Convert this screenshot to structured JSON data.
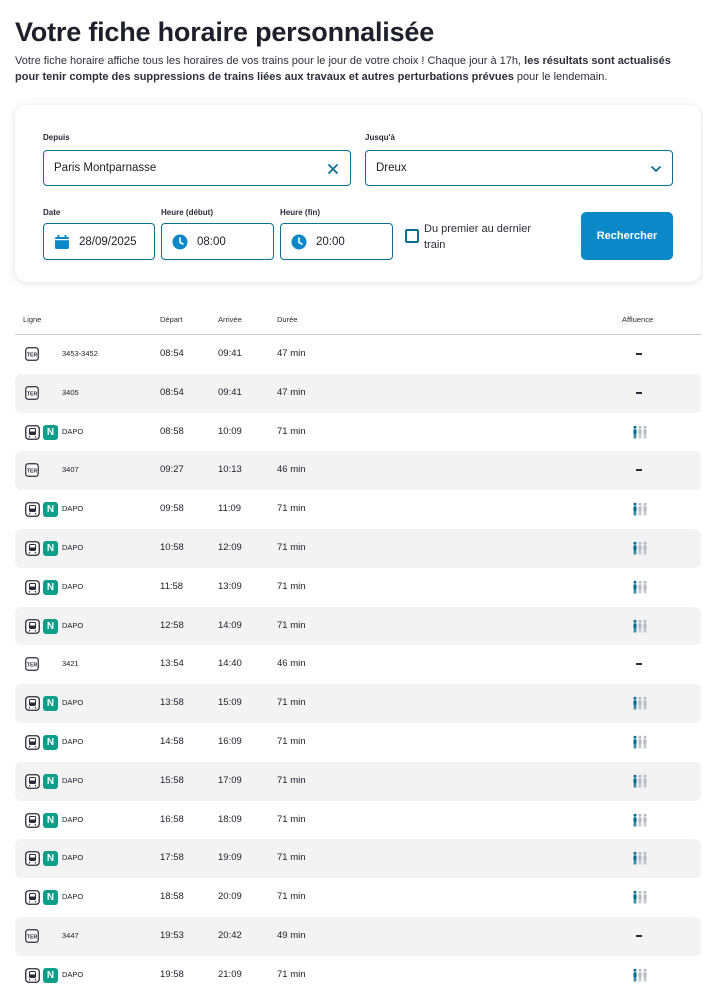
{
  "page": {
    "title": "Votre fiche horaire personnalisée",
    "intro_start": "Votre fiche horaire affiche tous les horaires de vos trains pour le jour de votre choix ! Chaque jour à 17h, ",
    "intro_bold": "les résultats sont actualisés pour tenir compte des suppressions de trains liées aux travaux et autres perturbations prévues",
    "intro_end": " pour le lendemain."
  },
  "form": {
    "from_label": "Depuis",
    "from_value": "Paris Montparnasse",
    "to_label": "Jusqu'à",
    "to_value": "Dreux",
    "date_label": "Date",
    "date_value": "28/09/2025",
    "start_label": "Heure (début)",
    "start_value": "08:00",
    "end_label": "Heure (fin)",
    "end_value": "20:00",
    "checkbox_label": "Du premier au dernier train",
    "search_button": "Rechercher"
  },
  "table": {
    "headers": {
      "ligne": "Ligne",
      "depart": "Départ",
      "arrivee": "Arrivée",
      "duree": "Durée",
      "affluence": "Affluence"
    },
    "rows": [
      {
        "type": "TER",
        "line": "3453-3452",
        "dep": "08:54",
        "arr": "09:41",
        "dur": "47 min",
        "aff": "none"
      },
      {
        "type": "TER",
        "line": "3405",
        "dep": "08:54",
        "arr": "09:41",
        "dur": "47 min",
        "aff": "none"
      },
      {
        "type": "N",
        "line": "DAPO",
        "dep": "08:58",
        "arr": "10:09",
        "dur": "71 min",
        "aff": "low"
      },
      {
        "type": "TER",
        "line": "3407",
        "dep": "09:27",
        "arr": "10:13",
        "dur": "46 min",
        "aff": "none"
      },
      {
        "type": "N",
        "line": "DAPO",
        "dep": "09:58",
        "arr": "11:09",
        "dur": "71 min",
        "aff": "low"
      },
      {
        "type": "N",
        "line": "DAPO",
        "dep": "10:58",
        "arr": "12:09",
        "dur": "71 min",
        "aff": "low"
      },
      {
        "type": "N",
        "line": "DAPO",
        "dep": "11:58",
        "arr": "13:09",
        "dur": "71 min",
        "aff": "low"
      },
      {
        "type": "N",
        "line": "DAPO",
        "dep": "12:58",
        "arr": "14:09",
        "dur": "71 min",
        "aff": "low"
      },
      {
        "type": "TER",
        "line": "3421",
        "dep": "13:54",
        "arr": "14:40",
        "dur": "46 min",
        "aff": "none"
      },
      {
        "type": "N",
        "line": "DAPO",
        "dep": "13:58",
        "arr": "15:09",
        "dur": "71 min",
        "aff": "low"
      },
      {
        "type": "N",
        "line": "DAPO",
        "dep": "14:58",
        "arr": "16:09",
        "dur": "71 min",
        "aff": "low"
      },
      {
        "type": "N",
        "line": "DAPO",
        "dep": "15:58",
        "arr": "17:09",
        "dur": "71 min",
        "aff": "low"
      },
      {
        "type": "N",
        "line": "DAPO",
        "dep": "16:58",
        "arr": "18:09",
        "dur": "71 min",
        "aff": "low"
      },
      {
        "type": "N",
        "line": "DAPO",
        "dep": "17:58",
        "arr": "19:09",
        "dur": "71 min",
        "aff": "low"
      },
      {
        "type": "N",
        "line": "DAPO",
        "dep": "18:58",
        "arr": "20:09",
        "dur": "71 min",
        "aff": "low"
      },
      {
        "type": "TER",
        "line": "3447",
        "dep": "19:53",
        "arr": "20:42",
        "dur": "49 min",
        "aff": "none"
      },
      {
        "type": "N",
        "line": "DAPO",
        "dep": "19:58",
        "arr": "21:09",
        "dur": "71 min",
        "aff": "low"
      }
    ]
  },
  "icons": {
    "ter": "ter-badge-icon",
    "train": "train-icon",
    "transilien_n": "N",
    "affluence": "people-icon",
    "calendar": "calendar-icon",
    "clock": "clock-icon",
    "clear": "close-icon",
    "chevron": "chevron-down-icon"
  },
  "colors": {
    "accent": "#0b6f93",
    "button": "#0b88c8",
    "line_n": "#0c9e89",
    "affluence_active": "#0b6f93",
    "affluence_inactive": "#b8bcc4",
    "row_alt": "#f3f3f4"
  }
}
